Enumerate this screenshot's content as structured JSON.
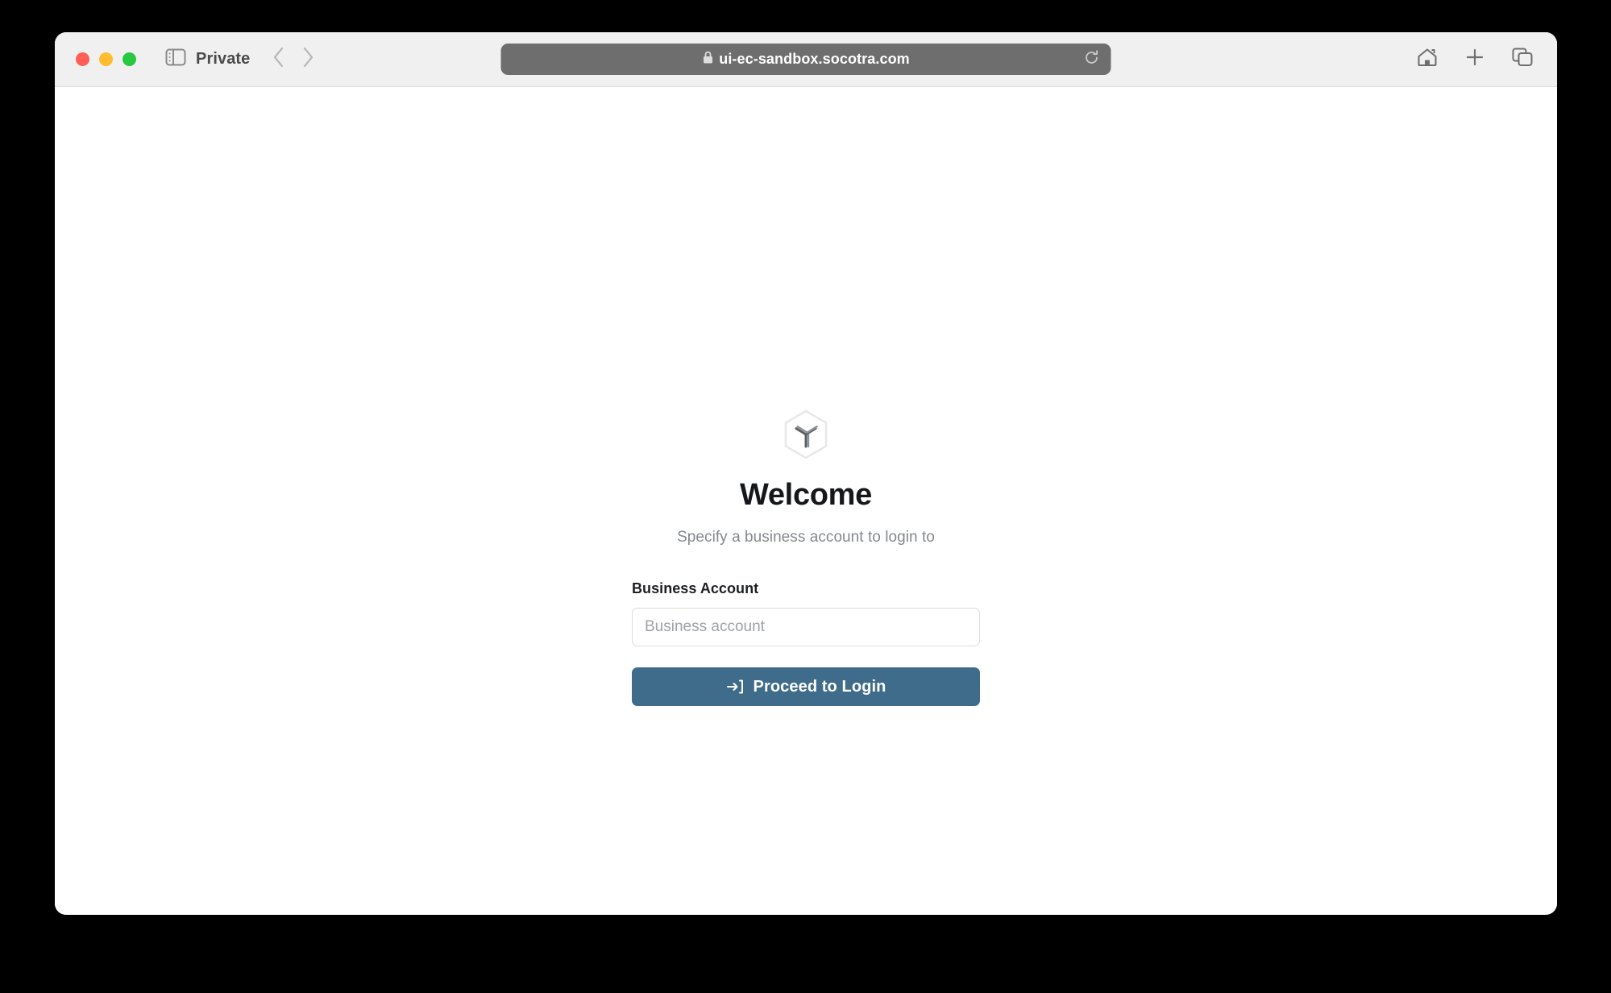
{
  "browser": {
    "traffic_lights": {
      "close_color": "#ff5f57",
      "minimize_color": "#febc2e",
      "zoom_color": "#28c840"
    },
    "sidebar_toggle_icon": "sidebar-icon",
    "private_label": "Private",
    "back_icon": "chevron-left-icon",
    "forward_icon": "chevron-right-icon",
    "address_bar": {
      "lock_icon": "lock-icon",
      "url": "ui-ec-sandbox.socotra.com",
      "reload_icon": "reload-icon",
      "background_color": "#6e6e6e"
    },
    "right_icons": [
      {
        "name": "home-icon"
      },
      {
        "name": "new-tab-icon"
      },
      {
        "name": "tab-overview-icon"
      }
    ]
  },
  "login": {
    "logo_icon": "socotra-hexagon-logo",
    "title": "Welcome",
    "subtitle": "Specify a business account to login to",
    "field": {
      "label": "Business Account",
      "value": "",
      "placeholder": "Business account"
    },
    "submit": {
      "label": "Proceed to Login",
      "icon": "sign-in-icon",
      "color": "#406c8b"
    }
  }
}
